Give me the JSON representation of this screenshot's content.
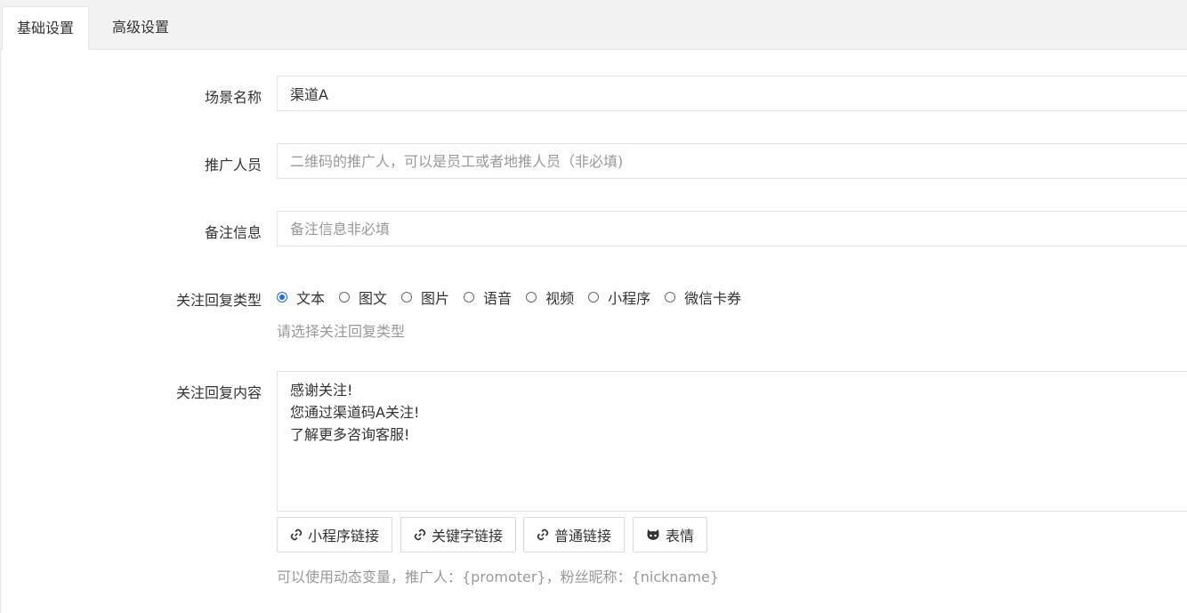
{
  "tabs": [
    {
      "label": "基础设置",
      "active": true
    },
    {
      "label": "高级设置",
      "active": false
    }
  ],
  "form": {
    "scene_name": {
      "label": "场景名称",
      "value": "渠道A"
    },
    "promoter": {
      "label": "推广人员",
      "placeholder": "二维码的推广人，可以是员工或者地推人员（非必填)"
    },
    "remark": {
      "label": "备注信息",
      "placeholder": "备注信息非必填"
    },
    "reply_type": {
      "label": "关注回复类型",
      "options": [
        "文本",
        "图文",
        "图片",
        "语音",
        "视频",
        "小程序",
        "微信卡券"
      ],
      "selected": "文本",
      "hint": "请选择关注回复类型"
    },
    "reply_content": {
      "label": "关注回复内容",
      "value": "感谢关注!\n您通过渠道码A关注!\n了解更多咨询客服!"
    },
    "buttons": {
      "mini_program_link": "小程序链接",
      "keyword_link": "关键字链接",
      "normal_link": "普通链接",
      "emoji": "表情"
    },
    "variables_hint": "可以使用动态变量，推广人：{promoter}，粉丝昵称：{nickname}"
  },
  "colors": {
    "accent": "#1e6fdc",
    "border": "#e6e6e6",
    "hint": "#999999"
  },
  "icons": {
    "link": "link-icon",
    "emoji": "github-cat-icon"
  }
}
